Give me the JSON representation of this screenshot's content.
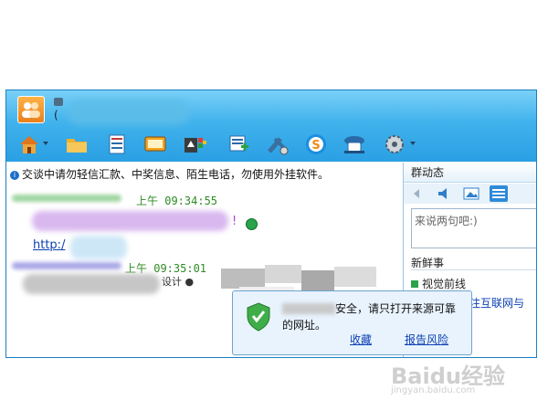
{
  "window": {
    "title_paren": "(",
    "toolbar_icons": [
      "home-icon",
      "folder-icon",
      "notebook-icon",
      "tv-icon",
      "apps-icon",
      "message-add-icon",
      "tools-icon",
      "soso-icon",
      "assistant-icon",
      "settings-icon"
    ]
  },
  "chat": {
    "notice": "交谈中请勿轻信汇款、中奖信息、陌生电话，勿使用外挂软件。",
    "notice_icon": "info-icon",
    "messages": [
      {
        "time": "上午 09:34:55",
        "text_end": "!"
      },
      {
        "link": "http:/"
      },
      {
        "time": "上午 09:35:01",
        "text_fragment": "设计 ●"
      }
    ]
  },
  "side": {
    "title": "群动态",
    "input_placeholder": "来说两句吧:)",
    "news_title": "新鲜事",
    "news_item": "视觉前线",
    "news_link": "注互联网与"
  },
  "security_popup": {
    "text": "安全，请只打开来源可靠的网址。",
    "link_bookmark": "收藏",
    "link_report": "报告风险"
  },
  "watermark": {
    "brand": "Baidu经验",
    "url": "jingyan.baidu.com"
  },
  "colors": {
    "titlebar": "#2a9fe3",
    "time_green": "#2e8b22",
    "link_blue": "#0b3fb3"
  }
}
